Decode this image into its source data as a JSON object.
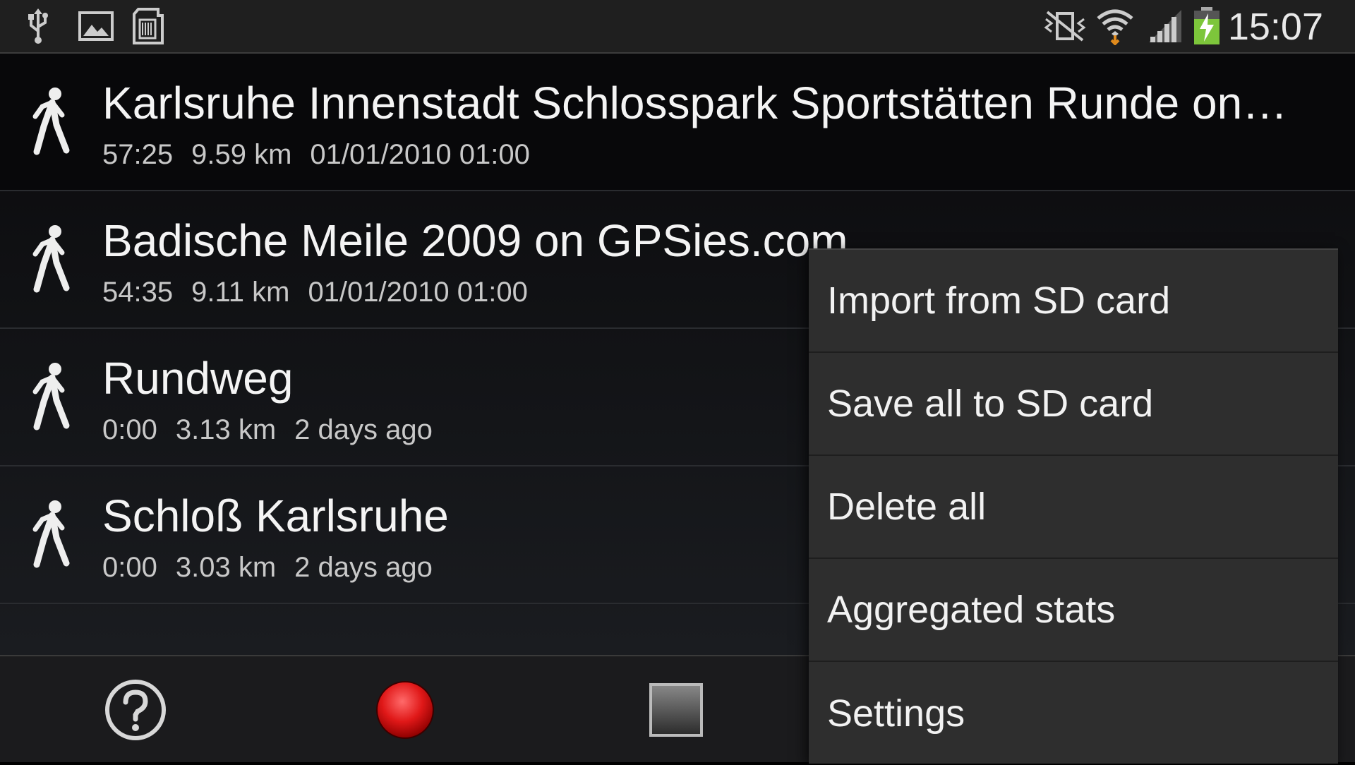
{
  "status_bar": {
    "clock": "15:07",
    "left_icons": [
      "usb-icon",
      "image-icon",
      "sd-card-icon"
    ],
    "right_icons": [
      "mute-vibrate-icon",
      "wifi-icon",
      "signal-icon",
      "battery-charging-icon"
    ]
  },
  "tracks": [
    {
      "title": "Karlsruhe Innenstadt Schlosspark Sportstätten Runde on…",
      "duration": "57:25",
      "distance": "9.59 km",
      "date": "01/01/2010 01:00",
      "icon": "walk-icon"
    },
    {
      "title": "Badische Meile 2009 on GPSies.com",
      "duration": "54:35",
      "distance": "9.11 km",
      "date": "01/01/2010 01:00",
      "icon": "walk-icon"
    },
    {
      "title": "Rundweg",
      "duration": "0:00",
      "distance": "3.13 km",
      "date": "2 days ago",
      "icon": "walk-icon"
    },
    {
      "title": "Schloß Karlsruhe",
      "duration": "0:00",
      "distance": "3.03 km",
      "date": "2 days ago",
      "icon": "walk-icon"
    }
  ],
  "bottom_bar": {
    "buttons": [
      "help-icon",
      "record-icon",
      "stop-icon"
    ]
  },
  "menu": {
    "items": [
      "Import from SD card",
      "Save all to SD card",
      "Delete all",
      "Aggregated stats",
      "Settings"
    ]
  },
  "colors": {
    "record": "#e01818",
    "battery": "#7dc63b",
    "wifi_arrow": "#e08a1c"
  }
}
